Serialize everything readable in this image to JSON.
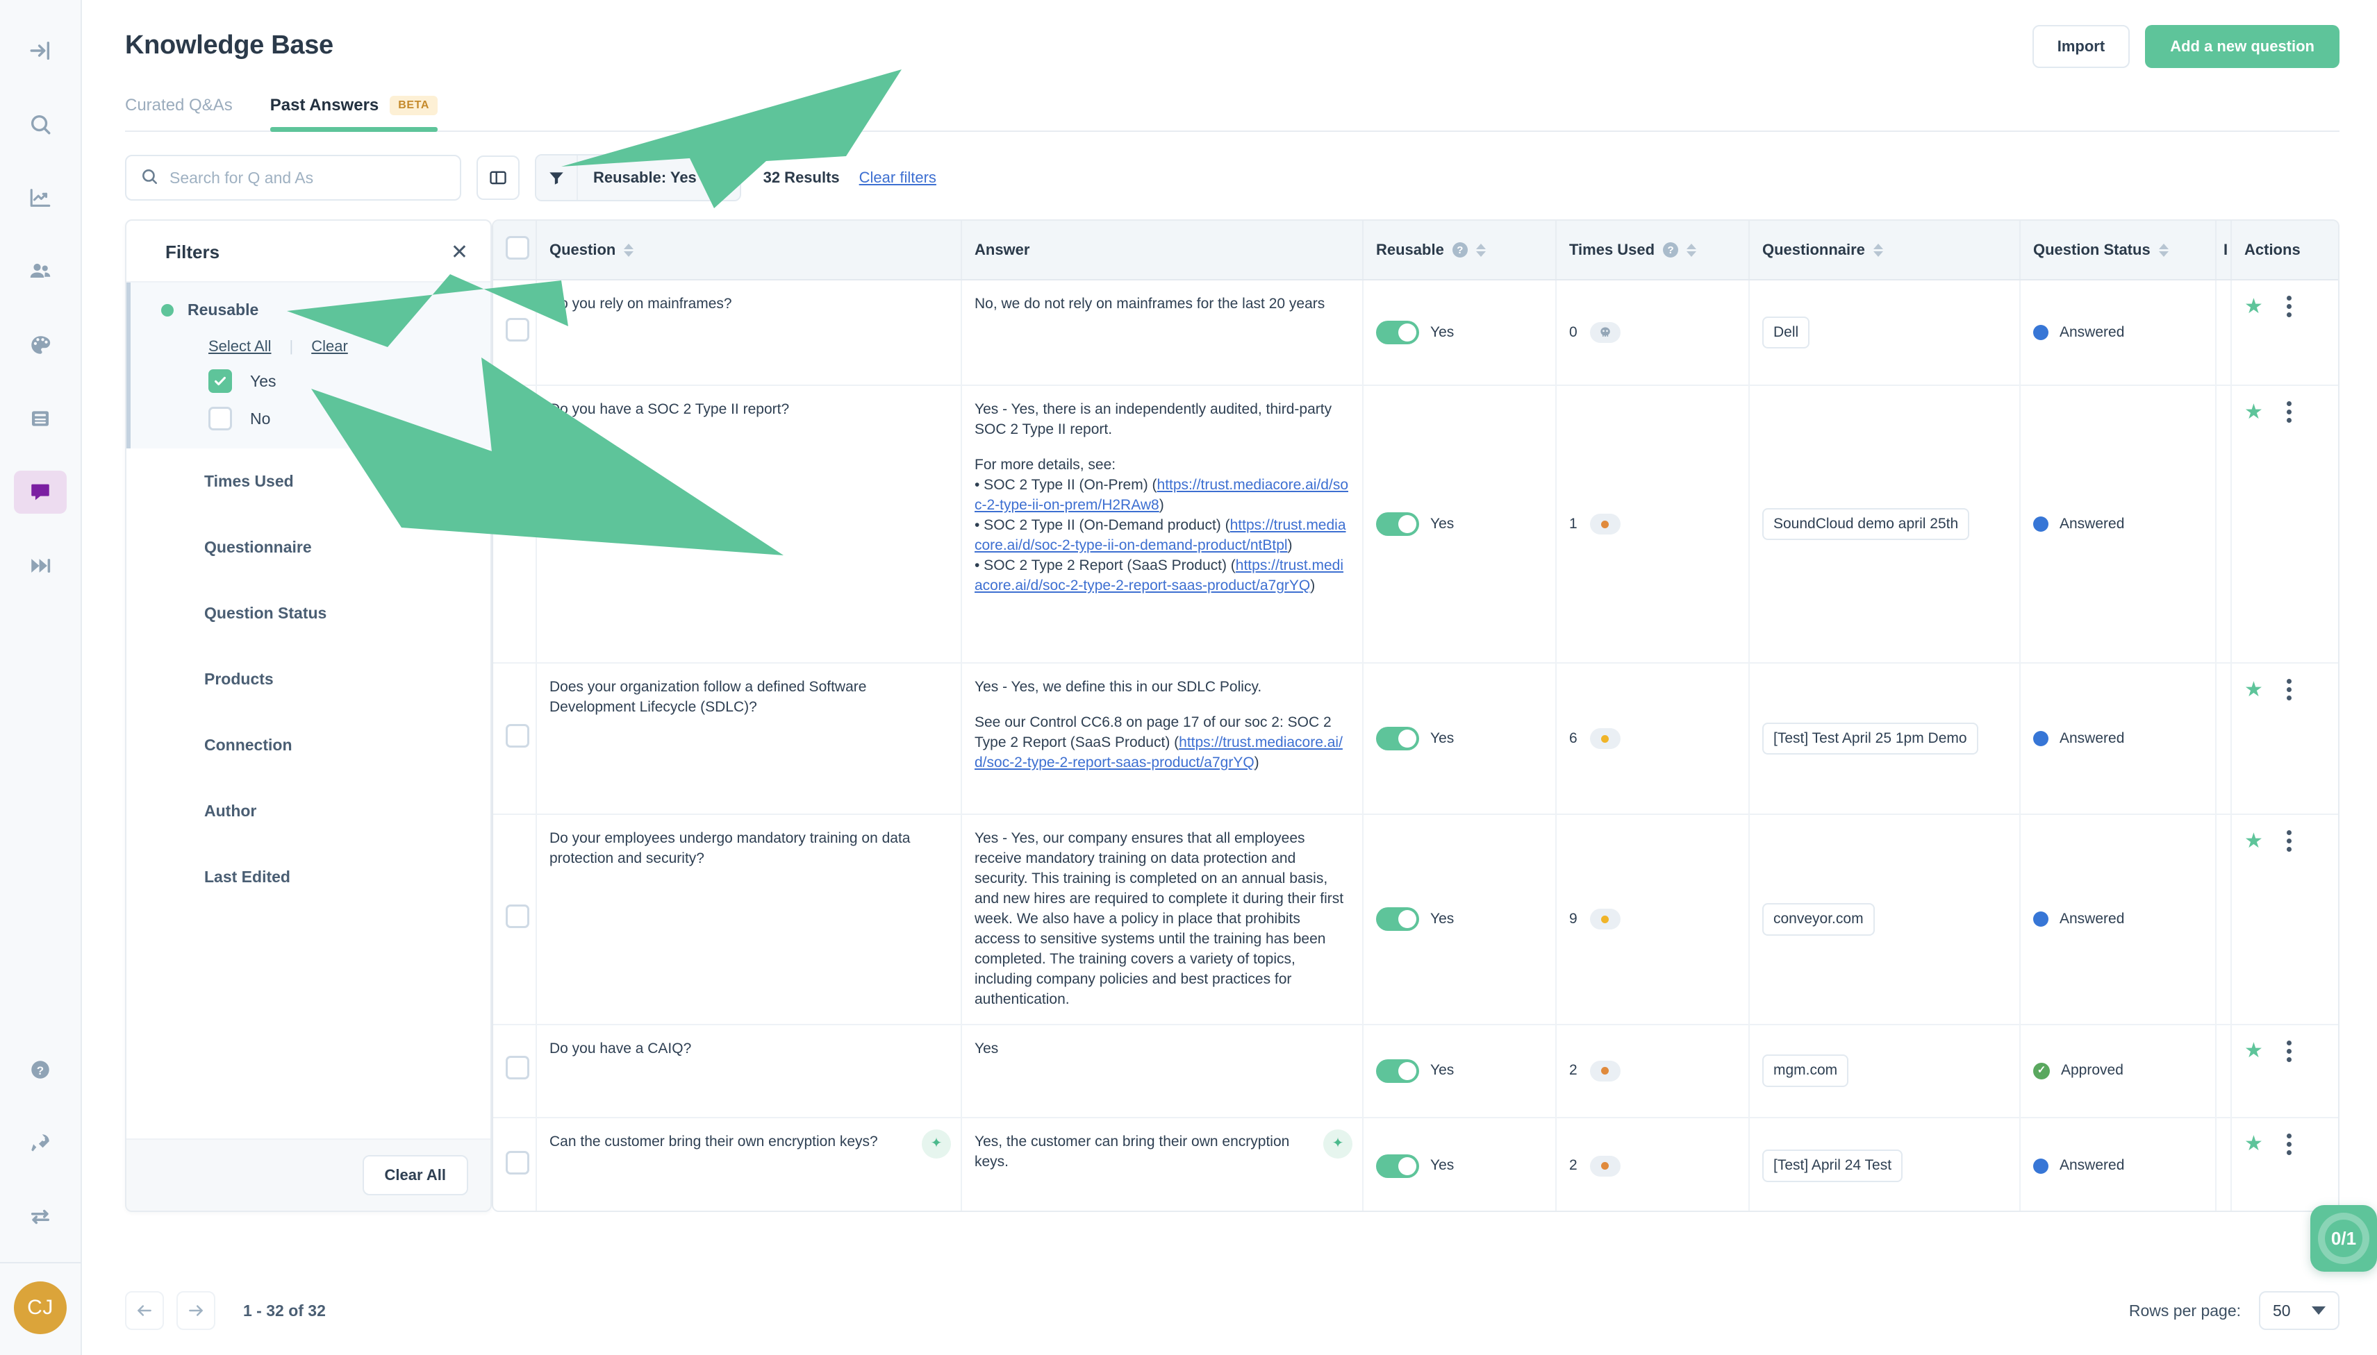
{
  "app": {
    "title": "Knowledge Base",
    "accent_green": "#5ec49a",
    "accent_blue": "#3d6fd1",
    "avatar_initials": "CJ"
  },
  "header": {
    "import_label": "Import",
    "add_question_label": "Add a new question"
  },
  "tabs": [
    {
      "label": "Curated Q&As",
      "active": false,
      "badge": ""
    },
    {
      "label": "Past Answers",
      "active": true,
      "badge": "BETA"
    }
  ],
  "toolbar": {
    "search_placeholder": "Search for Q and As",
    "search_value": "",
    "filter_chip": "Reusable: Yes",
    "results_text": "32 Results",
    "clear_filters_label": "Clear filters"
  },
  "filters_panel": {
    "title": "Filters",
    "close_label": "×",
    "select_all_label": "Select All",
    "clear_label": "Clear",
    "clear_all_label": "Clear All",
    "active_group": "Reusable",
    "options": [
      {
        "label": "Yes",
        "checked": true
      },
      {
        "label": "No",
        "checked": false
      }
    ],
    "groups": [
      "Times Used",
      "Questionnaire",
      "Question Status",
      "Products",
      "Connection",
      "Author",
      "Last Edited"
    ]
  },
  "table": {
    "columns": [
      {
        "label": "Question",
        "help": false,
        "sortable": true
      },
      {
        "label": "Answer",
        "help": false,
        "sortable": false
      },
      {
        "label": "Reusable",
        "help": true,
        "sortable": true
      },
      {
        "label": "Times Used",
        "help": true,
        "sortable": true
      },
      {
        "label": "Questionnaire",
        "help": false,
        "sortable": true
      },
      {
        "label": "Question Status",
        "help": false,
        "sortable": true
      },
      {
        "label": "I",
        "help": false,
        "sortable": false
      },
      {
        "label": "Actions",
        "help": false,
        "sortable": false
      }
    ],
    "rows": [
      {
        "question": "Do you rely on mainframes?",
        "question_ai": false,
        "answer_paragraphs": [
          {
            "text": "No, we do not rely on mainframes for the last 20 years",
            "links": []
          }
        ],
        "answer_ai": false,
        "reusable": "Yes",
        "times_used": "0",
        "times_used_dot": "#8fa3b5",
        "times_used_skull": true,
        "questionnaire": "Dell",
        "status": "Answered",
        "status_color": "#3776d6",
        "status_type": "dot"
      },
      {
        "question": "Do you have a SOC 2 Type II report?",
        "question_ai": false,
        "answer_paragraphs": [
          {
            "text": "Yes - Yes, there is an independently audited, third-party SOC 2 Type II report.",
            "links": []
          },
          {
            "text": "For more details, see:",
            "links": []
          },
          {
            "text": "• SOC 2 Type II (On-Prem) (",
            "links": [
              "https://trust.mediacore.ai/d/soc-2-type-ii-on-prem/H2RAw8"
            ],
            "suffix": ")"
          },
          {
            "text": "• SOC 2 Type II (On-Demand product) (",
            "links": [
              "https://trust.mediacore.ai/d/soc-2-type-ii-on-demand-product/ntBtpl"
            ],
            "suffix": ")"
          },
          {
            "text": "• SOC 2 Type 2 Report (SaaS Product) (",
            "links": [
              "https://trust.mediacore.ai/d/soc-2-type-2-report-saas-product/a7grYQ"
            ],
            "suffix": ")"
          }
        ],
        "answer_ai": false,
        "reusable": "Yes",
        "times_used": "1",
        "times_used_dot": "#e08a3c",
        "times_used_skull": false,
        "questionnaire": "SoundCloud demo april 25th",
        "status": "Answered",
        "status_color": "#3776d6",
        "status_type": "dot"
      },
      {
        "question": "Does your organization follow a defined Software Development Lifecycle (SDLC)?",
        "question_ai": false,
        "answer_paragraphs": [
          {
            "text": "Yes - Yes, we define this in our SDLC Policy.",
            "links": []
          },
          {
            "text": "See our Control CC6.8 on page 17 of our soc 2: SOC 2 Type 2 Report (SaaS Product) (",
            "links": [
              "https://trust.mediacore.ai/d/soc-2-type-2-report-saas-product/a7grYQ"
            ],
            "suffix": ")"
          }
        ],
        "answer_ai": false,
        "reusable": "Yes",
        "times_used": "6",
        "times_used_dot": "#f0b429",
        "times_used_skull": false,
        "questionnaire": "[Test] Test April 25 1pm Demo",
        "status": "Answered",
        "status_color": "#3776d6",
        "status_type": "dot"
      },
      {
        "question": "Do your employees undergo mandatory training on data protection and security?",
        "question_ai": false,
        "answer_paragraphs": [
          {
            "text": "Yes - Yes, our company ensures that all employees receive mandatory training on data protection and security. This training is completed on an annual basis, and new hires are required to complete it during their first week. We also have a policy in place that prohibits access to sensitive systems until the training has been completed. The training covers a variety of topics, including company policies and best practices for authentication.",
            "links": []
          }
        ],
        "answer_ai": false,
        "reusable": "Yes",
        "times_used": "9",
        "times_used_dot": "#f0b429",
        "times_used_skull": false,
        "questionnaire": "conveyor.com",
        "status": "Answered",
        "status_color": "#3776d6",
        "status_type": "dot"
      },
      {
        "question": "Do you have a CAIQ?",
        "question_ai": false,
        "answer_paragraphs": [
          {
            "text": "Yes",
            "links": []
          }
        ],
        "answer_ai": false,
        "reusable": "Yes",
        "times_used": "2",
        "times_used_dot": "#e08a3c",
        "times_used_skull": false,
        "questionnaire": "mgm.com",
        "status": "Approved",
        "status_color": "#5aa85f",
        "status_type": "check"
      },
      {
        "question": "Can the customer bring their own encryption keys?",
        "question_ai": true,
        "answer_paragraphs": [
          {
            "text": "Yes, the customer can bring their own encryption keys.",
            "links": []
          }
        ],
        "answer_ai": true,
        "reusable": "Yes",
        "times_used": "2",
        "times_used_dot": "#e08a3c",
        "times_used_skull": false,
        "questionnaire": "[Test] April 24 Test",
        "status": "Answered",
        "status_color": "#3776d6",
        "status_type": "dot"
      }
    ]
  },
  "footer": {
    "range_text": "1 - 32 of 32",
    "rows_per_page_label": "Rows per page:",
    "rows_per_page_value": "50"
  },
  "fab": {
    "label": "0/1"
  },
  "sidebar": {
    "items": [
      {
        "name": "collapse-icon"
      },
      {
        "name": "search-icon"
      },
      {
        "name": "analytics-icon"
      },
      {
        "name": "people-icon"
      },
      {
        "name": "palette-icon"
      },
      {
        "name": "library-icon"
      },
      {
        "name": "knowledge-base-icon"
      },
      {
        "name": "skip-forward-icon"
      }
    ],
    "bottom_items": [
      {
        "name": "help-icon"
      },
      {
        "name": "rocket-icon"
      },
      {
        "name": "switch-icon"
      }
    ]
  }
}
